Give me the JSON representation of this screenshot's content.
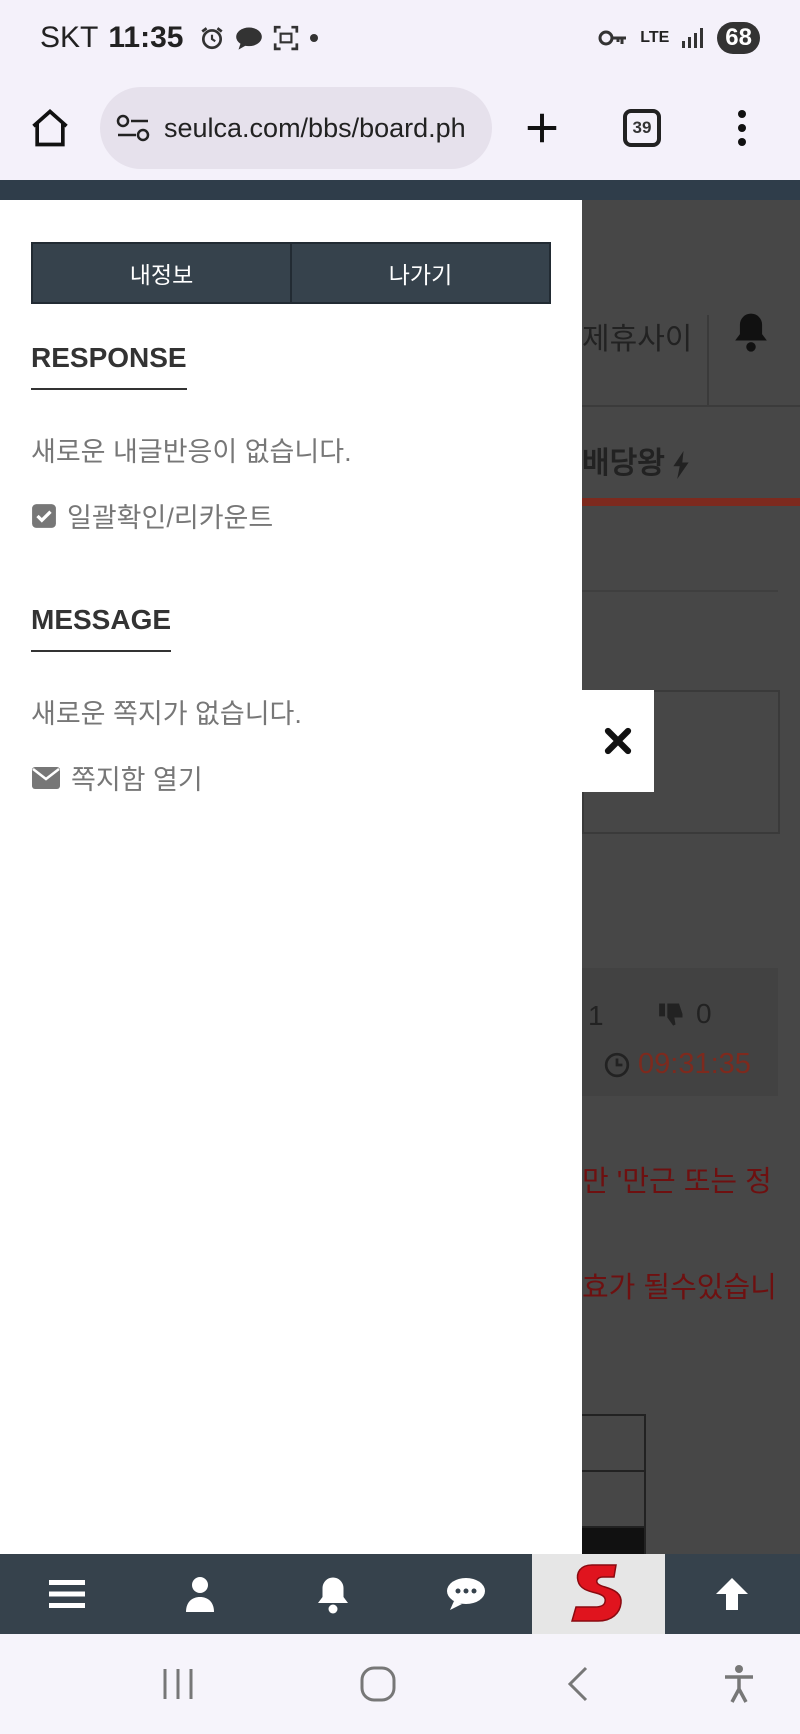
{
  "status_bar": {
    "carrier": "SKT",
    "time": "11:35",
    "network": "LTE",
    "battery": "68"
  },
  "browser": {
    "url": "seulca.com/bbs/board.ph",
    "tab_count": "39"
  },
  "panel": {
    "tabs": [
      {
        "label": "내정보"
      },
      {
        "label": "나가기"
      }
    ],
    "response": {
      "title": "RESPONSE",
      "empty_text": "새로운 내글반응이 없습니다.",
      "action_label": "일괄확인/리카운트"
    },
    "message": {
      "title": "MESSAGE",
      "empty_text": "새로운 쪽지가 없습니다.",
      "action_label": "쪽지함 열기"
    }
  },
  "background_page": {
    "nav_item_1": "제휴사이",
    "nav_item_2": "배당왕",
    "like_count": "1",
    "dislike_count": "0",
    "post_time": "09:31:35",
    "notice_line_1": "만 '만근 또는 정",
    "notice_line_2": "효가 될수있습니"
  },
  "bottom_nav": {
    "items": [
      "menu-icon",
      "user-icon",
      "bell-icon",
      "chat-icon",
      "site-logo",
      "arrow-up-icon"
    ]
  },
  "colors": {
    "panel_header": "#36424c",
    "accent_red": "#7d2a1e",
    "logo_red": "#e0141e"
  }
}
